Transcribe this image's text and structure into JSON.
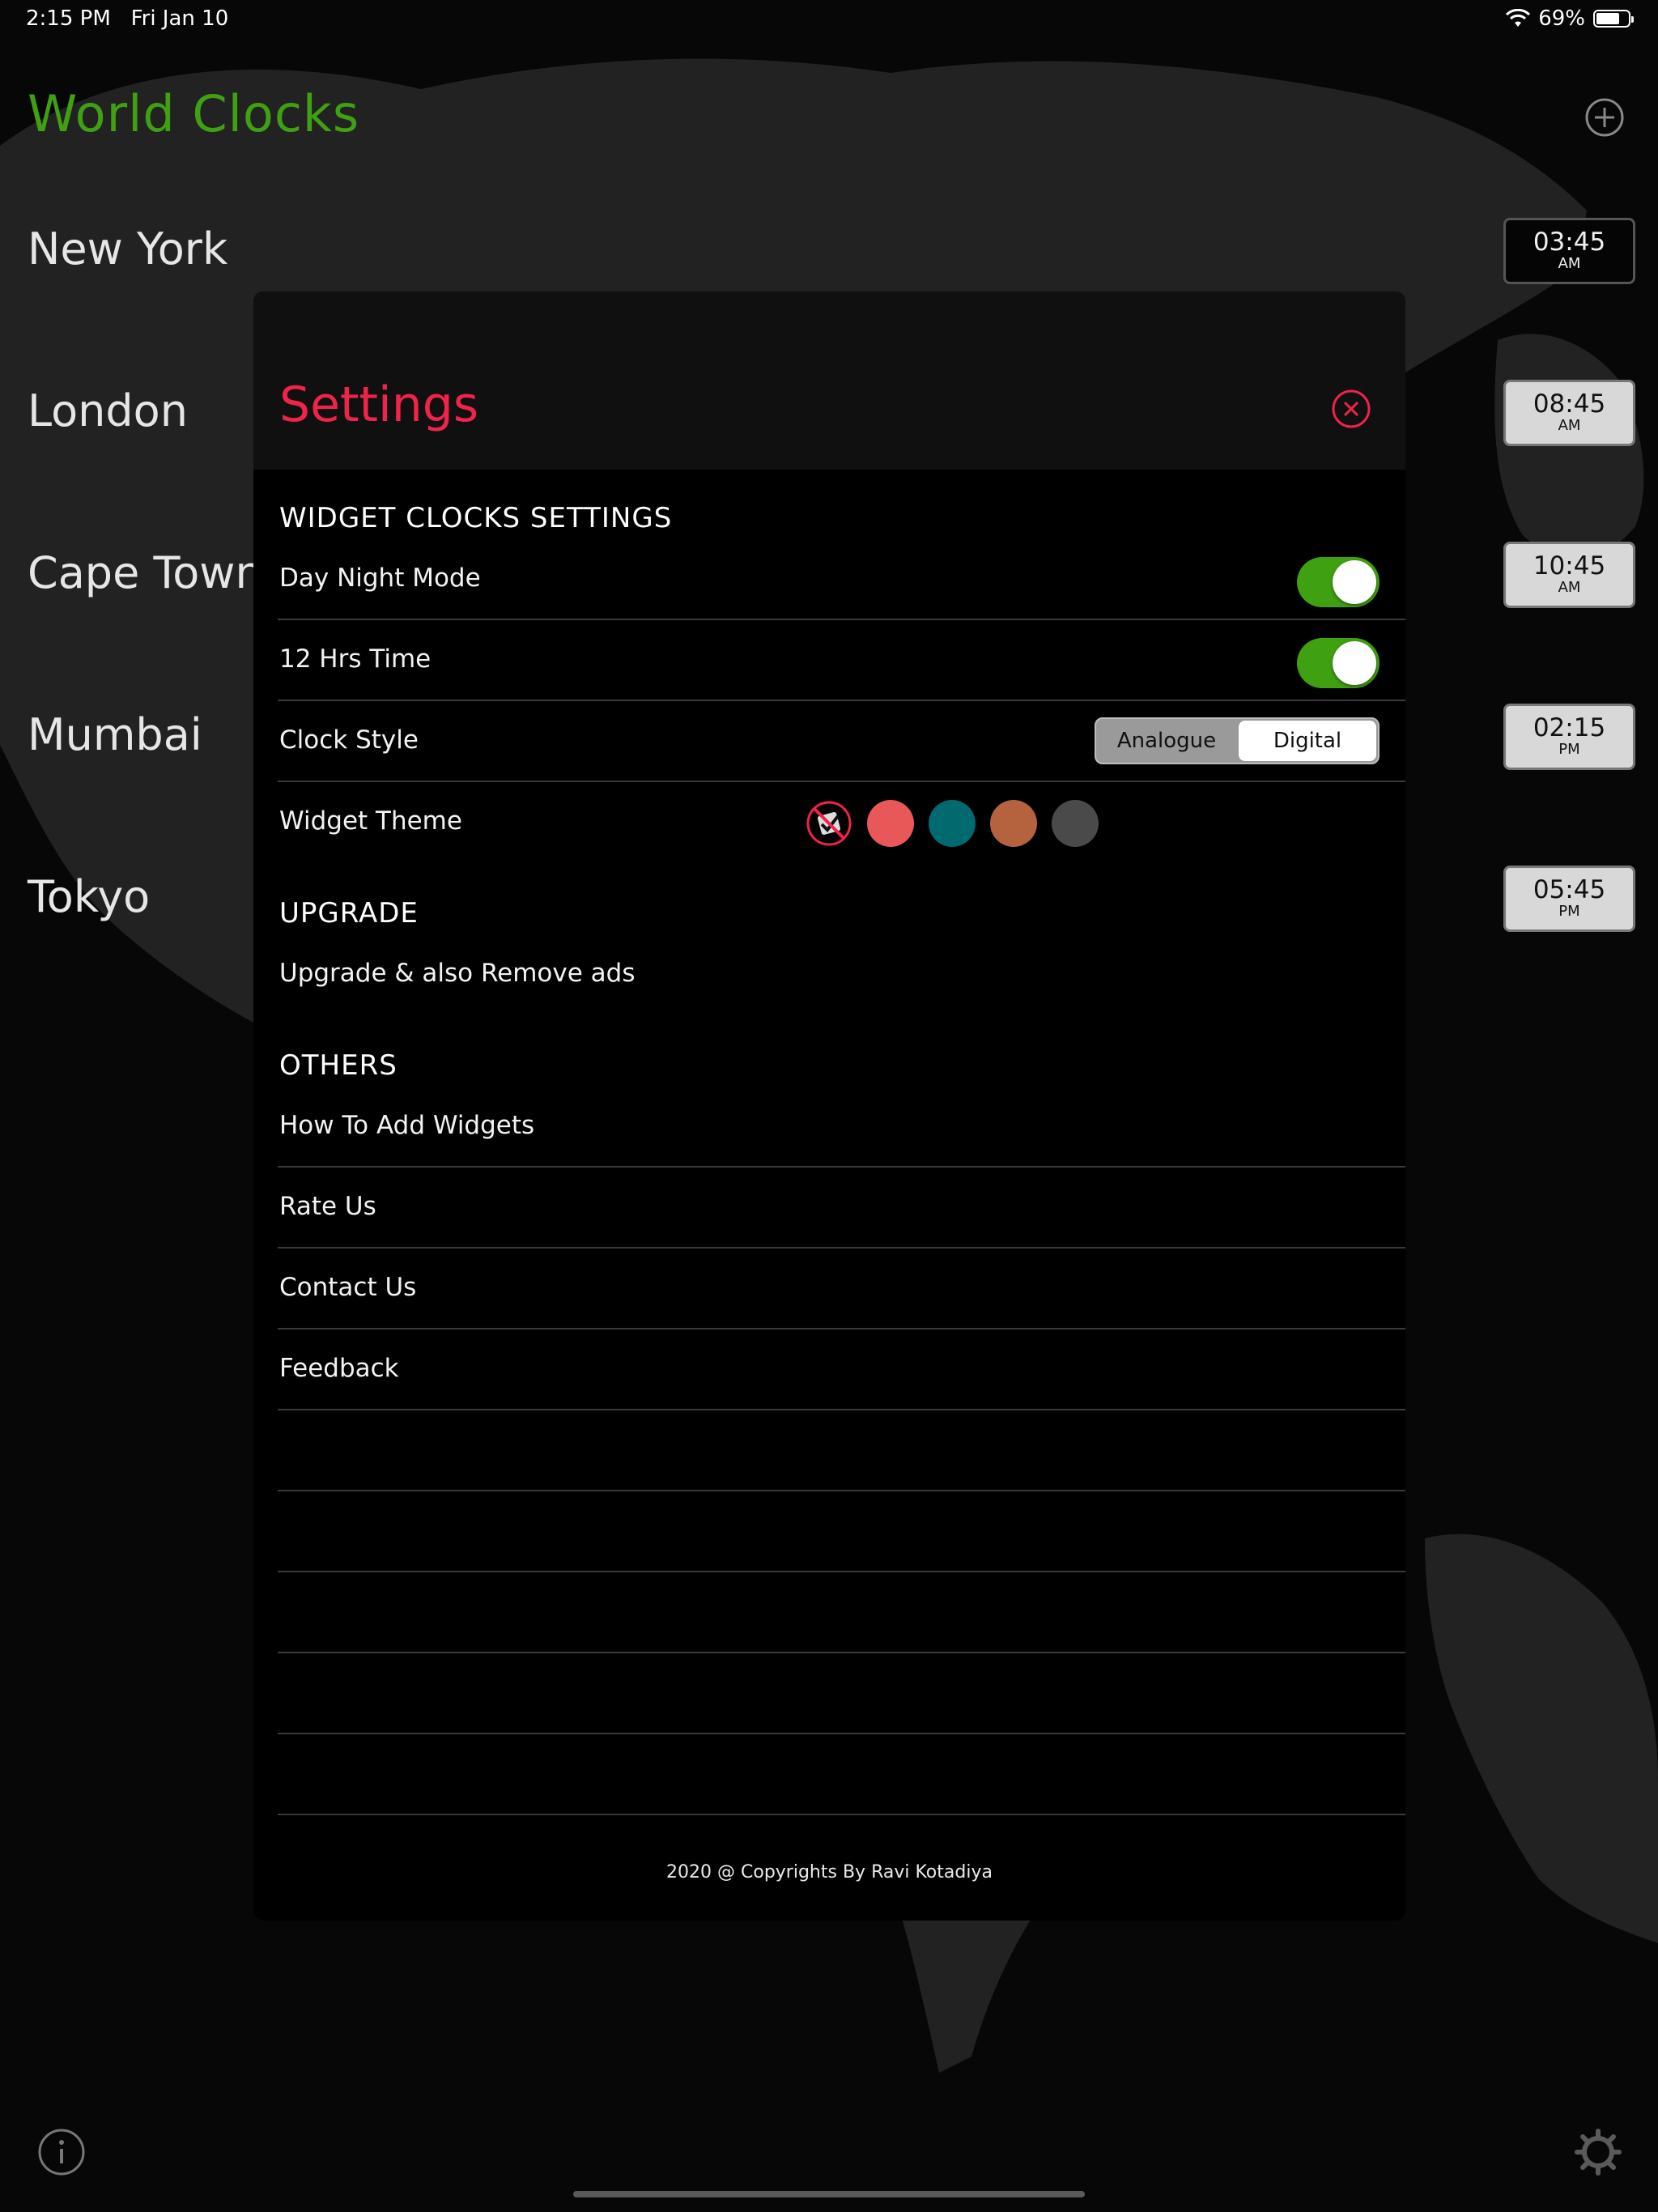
{
  "status_bar": {
    "time": "2:15 PM",
    "date": "Fri Jan 10",
    "battery": "69%"
  },
  "header": {
    "title": "World Clocks",
    "add_icon": "plus-circle-icon"
  },
  "cities": [
    {
      "name": "New York",
      "time": "03:45",
      "period": "AM",
      "dark": true
    },
    {
      "name": "London",
      "time": "08:45",
      "period": "AM",
      "dark": false
    },
    {
      "name": "Cape Town",
      "time": "10:45",
      "period": "AM",
      "dark": false
    },
    {
      "name": "Mumbai",
      "time": "02:15",
      "period": "PM",
      "dark": false
    },
    {
      "name": "Tokyo",
      "time": "05:45",
      "period": "PM",
      "dark": false
    }
  ],
  "settings": {
    "title": "Settings",
    "close_icon": "close-circle-icon",
    "widget_section": {
      "heading": "WIDGET CLOCKS SETTINGS",
      "day_night_mode": {
        "label": "Day Night Mode",
        "on": true
      },
      "twelve_hrs": {
        "label": "12 Hrs Time",
        "on": true
      },
      "clock_style": {
        "label": "Clock Style",
        "options": [
          "Analogue",
          "Digital"
        ],
        "selected": "Digital"
      },
      "widget_theme": {
        "label": "Widget Theme",
        "colors": [
          "#000000",
          "#e85858",
          "#006a6e",
          "#b5633f",
          "#4a4a4a"
        ],
        "selected_index": 0
      }
    },
    "upgrade_section": {
      "heading": "UPGRADE",
      "item": "Upgrade & also Remove ads"
    },
    "others_section": {
      "heading": "OTHERS",
      "items": [
        "How To Add Widgets",
        "Rate Us",
        "Contact Us",
        "Feedback"
      ]
    },
    "footer": "2020 @ Copyrights By Ravi Kotadiya"
  },
  "bottom": {
    "info_icon": "info-icon",
    "settings_icon": "gear-icon"
  },
  "colors": {
    "accent_green": "#3fa012",
    "accent_red": "#f0234a",
    "background": "#070707"
  }
}
